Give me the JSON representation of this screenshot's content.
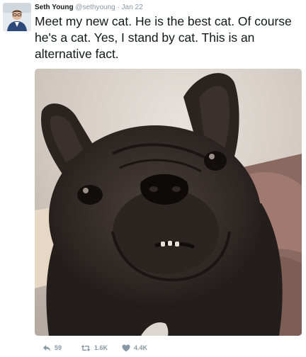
{
  "tweet": {
    "author": {
      "name": "Seth Young",
      "handle": "@sethyoung",
      "separator": "·",
      "date": "Jan 22"
    },
    "text": "Meet my new cat. He is the best cat. Of course he's a cat. Yes, I stand by cat. This is an alternative fact.",
    "media": {
      "icon": "photo-of-french-bulldog"
    },
    "actions": {
      "reply_count": "59",
      "retweet_count": "1.6K",
      "like_count": "4.4K"
    }
  },
  "colors": {
    "text": "#14171a",
    "muted": "#8899a6",
    "background": "#ffffff"
  }
}
